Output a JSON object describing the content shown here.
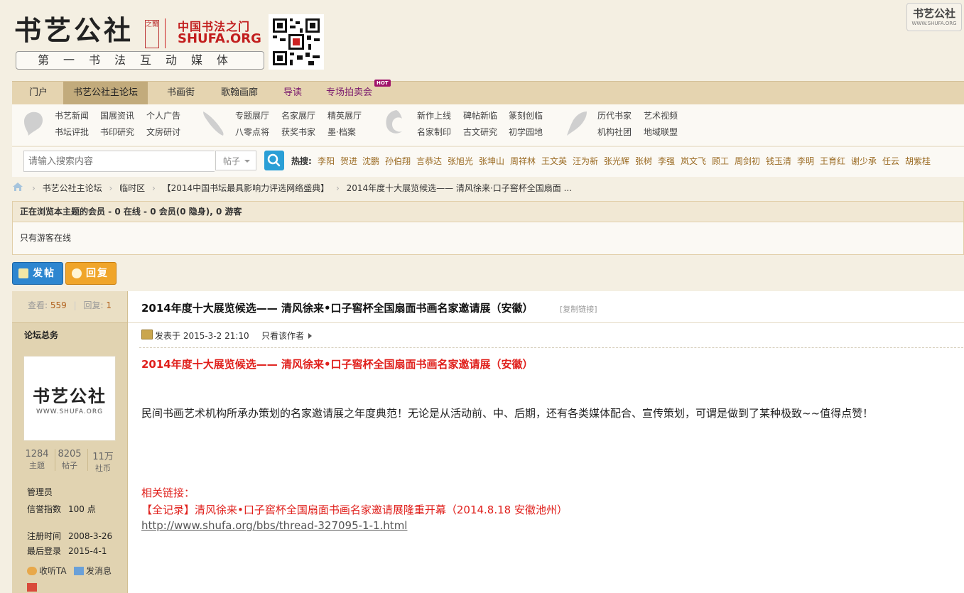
{
  "header": {
    "logo_text": "书艺公社",
    "logo_seal": "之蘭",
    "portal_cn": "中国书法之门",
    "portal_en": "SHUFA.ORG",
    "slogan": "第一书法互动媒体",
    "corner_logo_cn": "书艺公社",
    "corner_logo_en": "WWW.SHUFA.ORG"
  },
  "nav": {
    "items": [
      "门户",
      "书艺公社主论坛",
      "书画街",
      "歌翰画廊",
      "导读",
      "专场拍卖会"
    ],
    "hot_badge": "HOT"
  },
  "subnav": {
    "groups": [
      {
        "links": [
          "书艺新闻",
          "国展资讯",
          "个人广告",
          "书坛评批",
          "书印研究",
          "文房研讨"
        ]
      },
      {
        "links": [
          "专题展厅",
          "名家展厅",
          "精英展厅",
          "八零点将",
          "获奖书家",
          "墨·档案"
        ]
      },
      {
        "links": [
          "新作上线",
          "碑帖新临",
          "篆刻创临",
          "名家制印",
          "古文研究",
          "初学园地"
        ]
      },
      {
        "links": [
          "历代书家",
          "艺术视频",
          "机构社团",
          "地域联盟"
        ]
      }
    ]
  },
  "search": {
    "placeholder": "请输入搜索内容",
    "type": "帖子",
    "hot_label": "热搜:",
    "hot_words": [
      "李阳",
      "贺进",
      "沈鹏",
      "孙伯翔",
      "言恭达",
      "张旭光",
      "张坤山",
      "周祥林",
      "王文英",
      "汪为新",
      "张光辉",
      "张树",
      "李强",
      "岚文飞",
      "顾工",
      "周剑初",
      "钱玉清",
      "李明",
      "王育红",
      "谢少承",
      "任云",
      "胡紫桂"
    ]
  },
  "breadcrumb": [
    "书艺公社主论坛",
    "临时区",
    "【2014中国书坛最具影响力评选网络盛典】",
    "2014年度十大展览候选—— 清风徐来·口子窖杯全国扇面 ..."
  ],
  "online": {
    "header": "正在浏览本主题的会员 - 0 在线 - 0 会员(0 隐身), 0 游客",
    "body": "只有游客在线"
  },
  "buttons": {
    "post": "发帖",
    "reply": "回复"
  },
  "sidebar": {
    "views_label": "查看:",
    "views": "559",
    "replies_label": "回复:",
    "replies": "1",
    "username": "论坛总务",
    "avatar_cn": "书艺公社",
    "avatar_en": "WWW.SHUFA.ORG",
    "stats": [
      {
        "value": "1284",
        "label": "主题"
      },
      {
        "value": "8205",
        "label": "帖子"
      },
      {
        "value": "11万",
        "label": "社币"
      }
    ],
    "group": "管理员",
    "credit_label": "信誉指数",
    "credit_value": "100 点",
    "reg_label": "注册时间",
    "reg_value": "2008-3-26",
    "last_label": "最后登录",
    "last_value": "2015-4-1",
    "follow": "收听TA",
    "message": "发消息"
  },
  "post": {
    "title": "2014年度十大展览候选—— 清风徐来•口子窖杯全国扇面书画名家邀请展（安徽）",
    "copy_link": "[复制链接]",
    "posted": "发表于 2015-3-2 21:10",
    "only_author": "只看该作者",
    "body_title": "2014年度十大展览候选—— 清风徐来•口子窖杯全国扇面书画名家邀请展（安徽）",
    "body_text": "民间书画艺术机构所承办策划的名家邀请展之年度典范！无论是从活动前、中、后期，还有各类媒体配合、宣传策划，可谓是做到了某种极致~~值得点赞！",
    "related_label": "相关链接：",
    "related_title": "【全记录】清风徐来•口子窖杯全国扇面书画名家邀请展隆重开幕（2014.8.18 安徽池州）",
    "related_url": "http://www.shufa.org/bbs/thread-327095-1-1.html"
  },
  "colors": {
    "accent_red": "#e0201c",
    "nav_bg": "#e5d4b0",
    "sidebar_bg": "#e1d3b1",
    "button_blue": "#2d86d0",
    "button_orange": "#f0a52a"
  }
}
